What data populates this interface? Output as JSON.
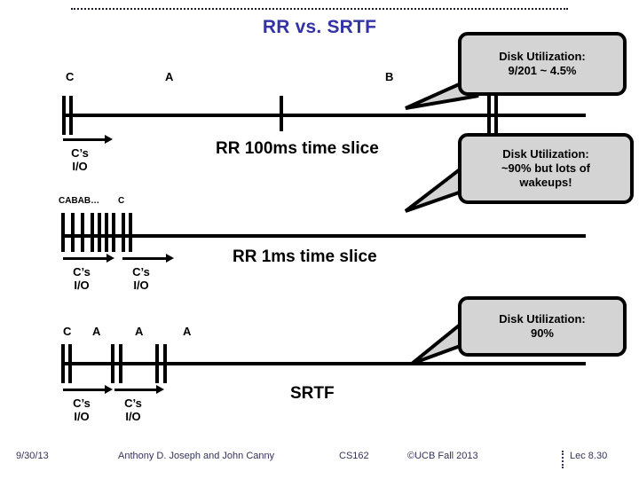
{
  "slide": {
    "title": "RR vs. SRTF",
    "title_color": "#3333a5",
    "accent_fill": "#d4d4d4"
  },
  "timelines": [
    {
      "id": "rr-100ms",
      "caption": "RR 100ms time slice",
      "labels": [
        "C",
        "A",
        "B"
      ],
      "io_captions": [
        "C’s I/O"
      ]
    },
    {
      "id": "rr-1ms",
      "caption": "RR 1ms time slice",
      "labels": [
        "CABAB…",
        "C"
      ],
      "io_captions": [
        "C’s I/O",
        "C’s I/O"
      ]
    },
    {
      "id": "srtf",
      "caption": "SRTF",
      "labels": [
        "C",
        "A",
        "A",
        "A"
      ],
      "io_captions": [
        "C’s I/O",
        "C’s I/O"
      ]
    }
  ],
  "labels": {
    "t1_c": "C",
    "t1_a": "A",
    "t1_b": "B",
    "t1_io1_line1": "C’s",
    "t1_io1_line2": "I/O",
    "t2_cabab": "CABAB…",
    "t2_c": "C",
    "t2_io1_line1": "C’s",
    "t2_io1_line2": "I/O",
    "t2_io2_line1": "C’s",
    "t2_io2_line2": "I/O",
    "t3_c": "C",
    "t3_a1": "A",
    "t3_a2": "A",
    "t3_a3": "A",
    "t3_io1_line1": "C’s",
    "t3_io1_line2": "I/O",
    "t3_io2_line1": "C’s",
    "t3_io2_line2": "I/O"
  },
  "captions": {
    "rr100": "RR 100ms time slice",
    "rr1": "RR 1ms time slice",
    "srtf": "SRTF"
  },
  "callouts": [
    {
      "id": "callout-rr100",
      "line1": "Disk Utilization:",
      "line2": "9/201 ~ 4.5%",
      "line3": ""
    },
    {
      "id": "callout-rr1",
      "line1": "Disk Utilization:",
      "line2": "~90% but lots of",
      "line3": "wakeups!"
    },
    {
      "id": "callout-srtf",
      "line1": "Disk Utilization:",
      "line2": "90%",
      "line3": ""
    }
  ],
  "footer": {
    "date": "9/30/13",
    "authors": "Anthony D. Joseph and John Canny",
    "course": "CS162",
    "copyright": "©UCB Fall 2013",
    "page": "Lec 8.30"
  }
}
